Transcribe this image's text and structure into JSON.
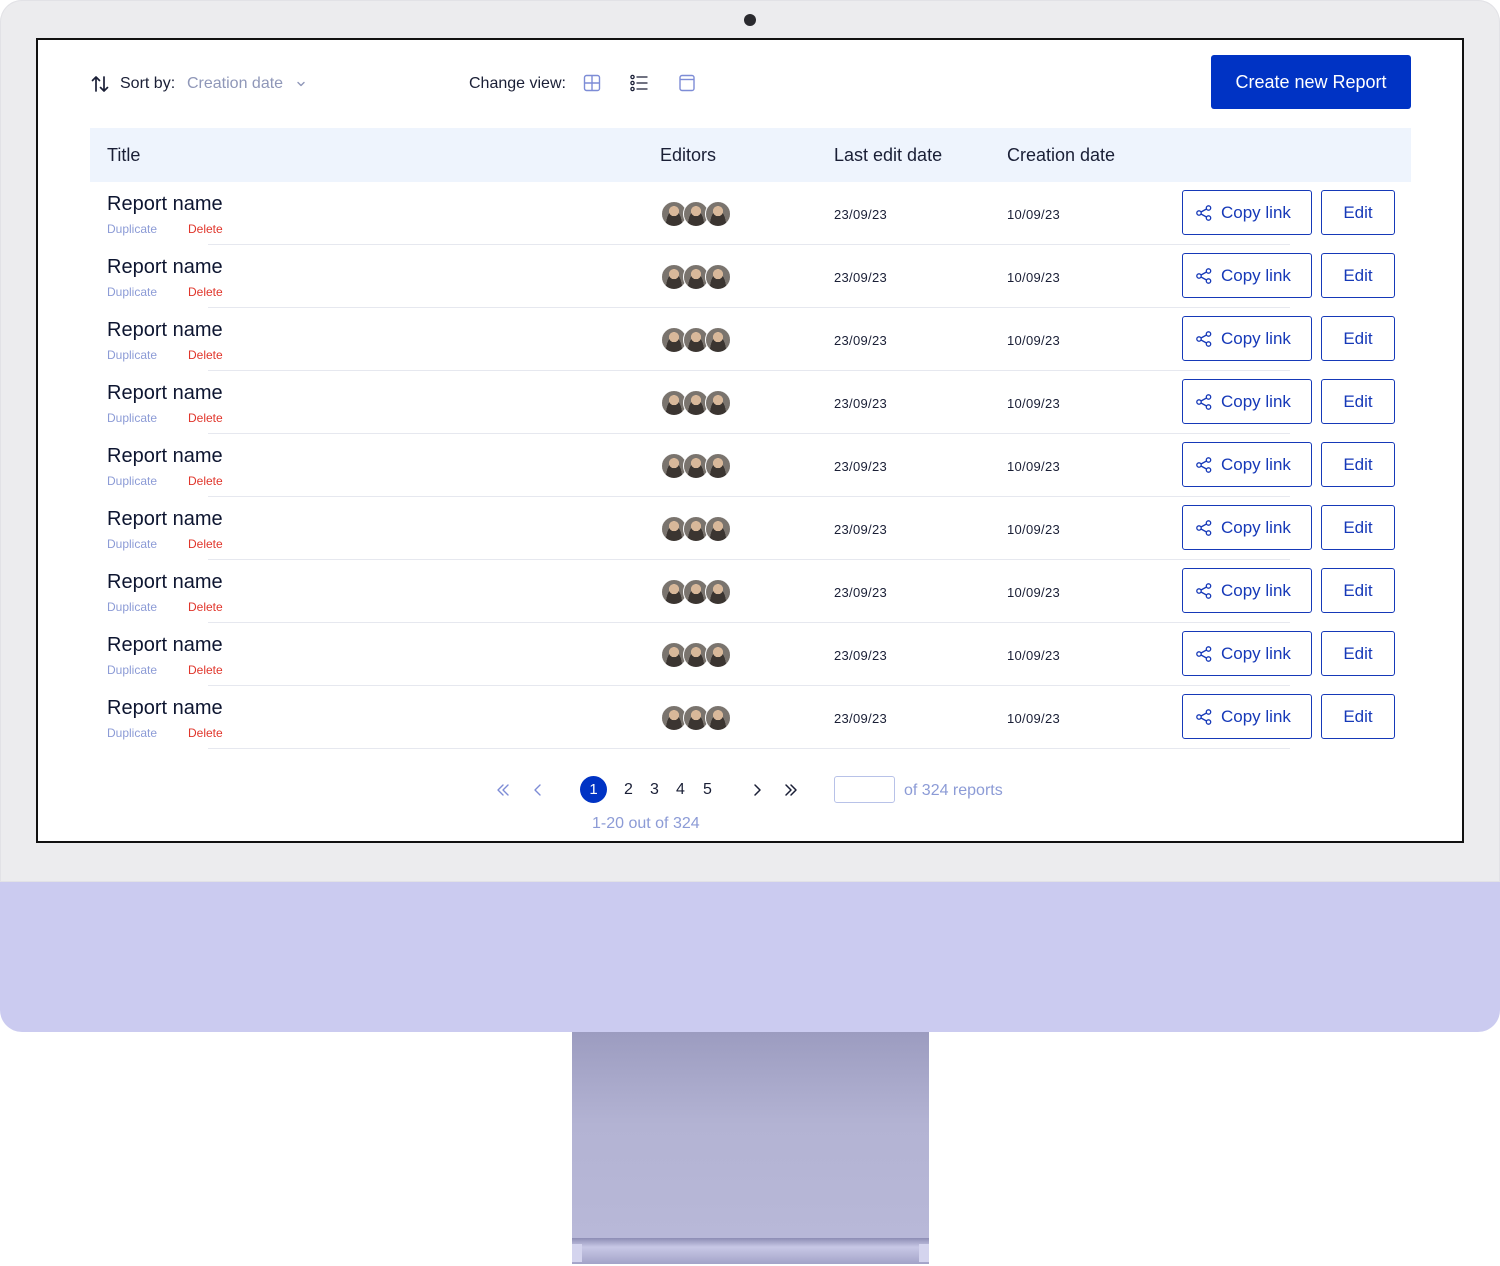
{
  "toolbar": {
    "sort_label": "Sort by:",
    "sort_value": "Creation date",
    "view_label": "Change view:",
    "create_button": "Create new Report"
  },
  "table": {
    "headers": {
      "title": "Title",
      "editors": "Editors",
      "last_edit": "Last edit date",
      "created": "Creation date"
    },
    "rows": [
      {
        "name": "Report name",
        "duplicate": "Duplicate",
        "delete": "Delete",
        "last_edit": "23/09/23",
        "created": "10/09/23",
        "copy": "Copy link",
        "edit": "Edit"
      },
      {
        "name": "Report name",
        "duplicate": "Duplicate",
        "delete": "Delete",
        "last_edit": "23/09/23",
        "created": "10/09/23",
        "copy": "Copy link",
        "edit": "Edit"
      },
      {
        "name": "Report name",
        "duplicate": "Duplicate",
        "delete": "Delete",
        "last_edit": "23/09/23",
        "created": "10/09/23",
        "copy": "Copy link",
        "edit": "Edit"
      },
      {
        "name": "Report name",
        "duplicate": "Duplicate",
        "delete": "Delete",
        "last_edit": "23/09/23",
        "created": "10/09/23",
        "copy": "Copy link",
        "edit": "Edit"
      },
      {
        "name": "Report name",
        "duplicate": "Duplicate",
        "delete": "Delete",
        "last_edit": "23/09/23",
        "created": "10/09/23",
        "copy": "Copy link",
        "edit": "Edit"
      },
      {
        "name": "Report name",
        "duplicate": "Duplicate",
        "delete": "Delete",
        "last_edit": "23/09/23",
        "created": "10/09/23",
        "copy": "Copy link",
        "edit": "Edit"
      },
      {
        "name": "Report name",
        "duplicate": "Duplicate",
        "delete": "Delete",
        "last_edit": "23/09/23",
        "created": "10/09/23",
        "copy": "Copy link",
        "edit": "Edit"
      },
      {
        "name": "Report name",
        "duplicate": "Duplicate",
        "delete": "Delete",
        "last_edit": "23/09/23",
        "created": "10/09/23",
        "copy": "Copy link",
        "edit": "Edit"
      },
      {
        "name": "Report name",
        "duplicate": "Duplicate",
        "delete": "Delete",
        "last_edit": "23/09/23",
        "created": "10/09/23",
        "copy": "Copy link",
        "edit": "Edit"
      }
    ]
  },
  "pagination": {
    "current": "1",
    "pages": [
      "2",
      "3",
      "4",
      "5"
    ],
    "input_value": "",
    "total_label": "of 324 reports",
    "range_label": "1-20 out of 324"
  },
  "colors": {
    "primary": "#0033c4",
    "header_bg": "#eef4fd",
    "muted": "#8c9bd6",
    "danger": "#e0352b",
    "chin": "#cbcbf0"
  },
  "icons": {
    "sort": "sort-arrows-icon",
    "chevron": "chevron-down-icon",
    "grid_view": "grid-view-icon",
    "list_view": "list-view-icon",
    "card_view": "card-view-icon",
    "share": "share-icon",
    "first": "double-chevron-left-icon",
    "prev": "chevron-left-icon",
    "next": "chevron-right-icon",
    "last": "double-chevron-right-icon"
  }
}
